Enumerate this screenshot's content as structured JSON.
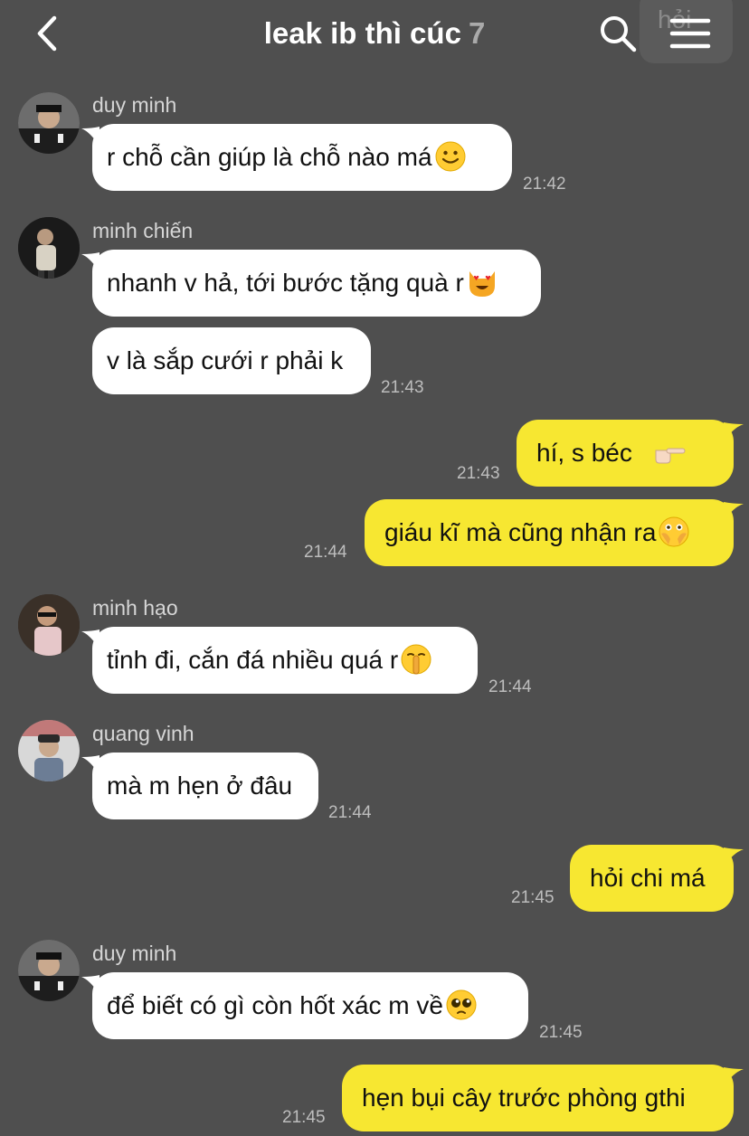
{
  "header": {
    "title": "leak ib thì cúc",
    "member_count": "7",
    "ghost_text": "hỏi"
  },
  "messages": [
    {
      "sender": "duy minh",
      "text": "r chỗ cần giúp là chỗ nào má",
      "emoji": "slightly-smiling-face",
      "time": "21:42"
    },
    {
      "sender": "minh chiến",
      "text": "nhanh v hả, tới bước tặng quà r",
      "emoji": "heart-eyes-cat",
      "time": ""
    },
    {
      "sender": "",
      "text": "v là sắp cưới r phải k",
      "emoji": "",
      "time": "21:43"
    },
    {
      "sender": "me",
      "text": "hí, s béc",
      "emoji": "pointing-hands",
      "time": "21:43"
    },
    {
      "sender": "me",
      "text": "giáu kĩ mà cũng nhận ra",
      "emoji": "face-with-open-eyes-hand-over-mouth",
      "time": "21:44"
    },
    {
      "sender": "minh hạo",
      "text": "tỉnh đi, cắn đá nhiều quá r",
      "emoji": "shushing-face",
      "time": "21:44"
    },
    {
      "sender": "quang vinh",
      "text": "mà m hẹn ở đâu",
      "emoji": "",
      "time": "21:44"
    },
    {
      "sender": "me",
      "text": "hỏi chi má",
      "emoji": "",
      "time": "21:45"
    },
    {
      "sender": "duy minh",
      "text": "để biết có gì còn hốt xác m về",
      "emoji": "pleading-face",
      "time": "21:45"
    },
    {
      "sender": "me",
      "text": "hẹn bụi cây trước phòng gthi",
      "emoji": "",
      "time": "21:45"
    }
  ],
  "colors": {
    "background": "#4f4f4f",
    "incoming_bubble": "#ffffff",
    "outgoing_bubble": "#f7e731",
    "timestamp": "#bdbdbd"
  }
}
